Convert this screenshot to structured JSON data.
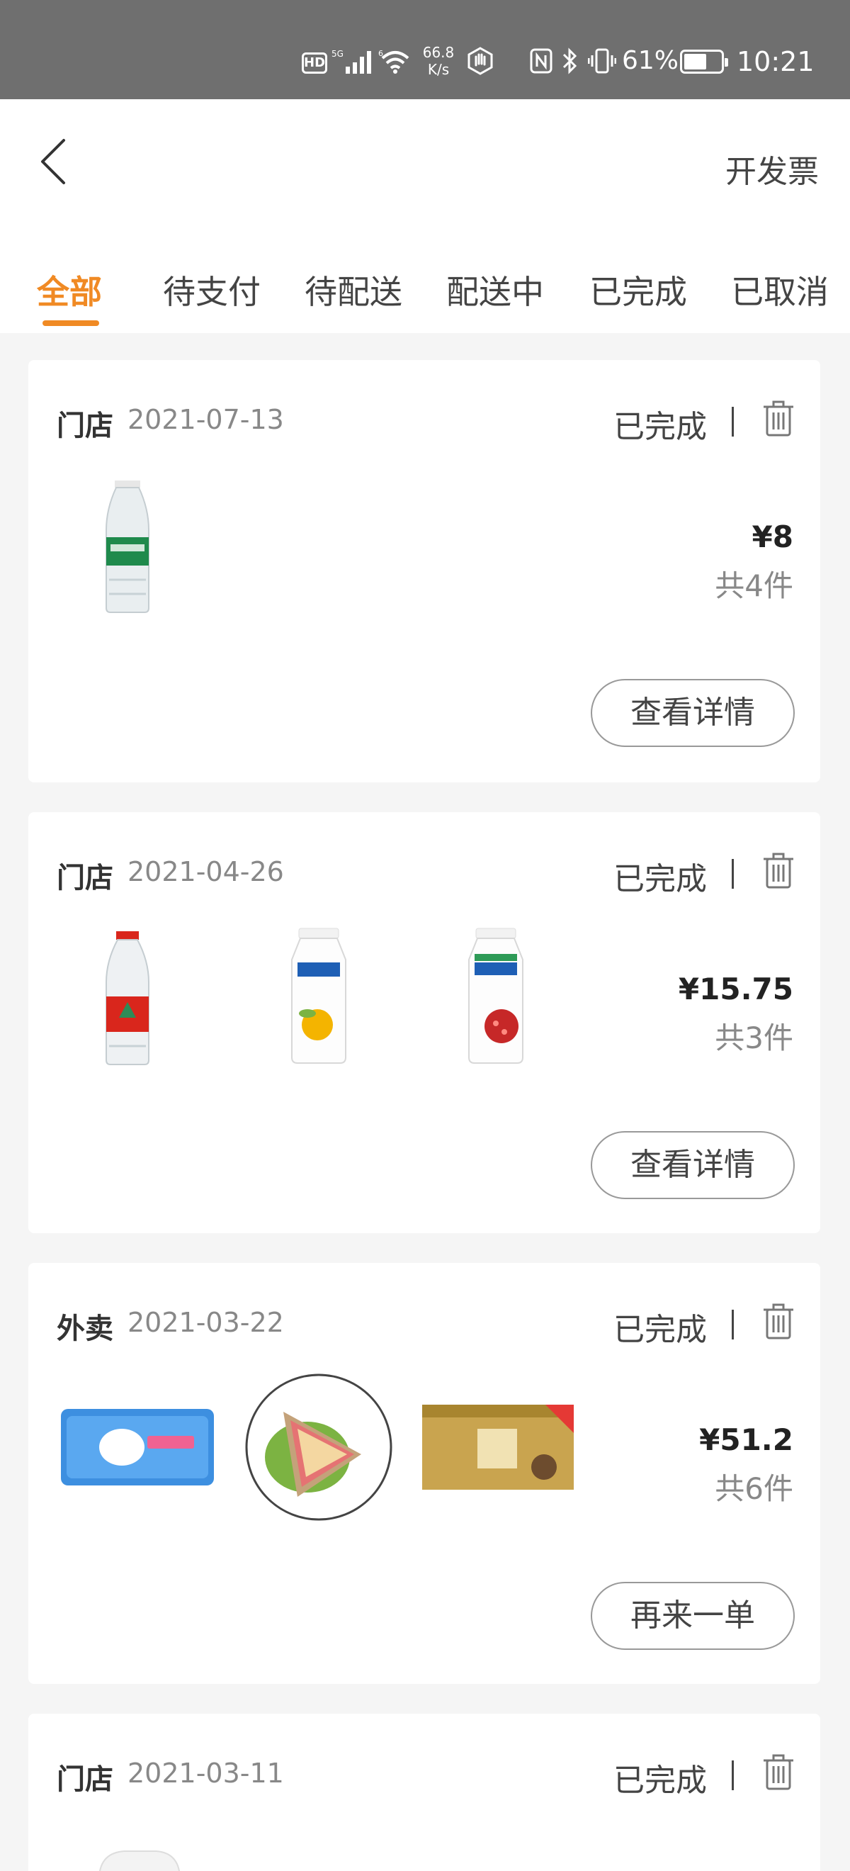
{
  "status_bar": {
    "hd": "HD",
    "network_speed_value": "66.8",
    "network_speed_unit": "K/s",
    "battery_percent": "61%",
    "battery_level": 0.61,
    "time": "10:21"
  },
  "header": {
    "back_icon": "chevron-left-icon",
    "invoice_label": "开发票"
  },
  "tabs": [
    {
      "label": "全部",
      "active": true
    },
    {
      "label": "待支付",
      "active": false
    },
    {
      "label": "待配送",
      "active": false
    },
    {
      "label": "配送中",
      "active": false
    },
    {
      "label": "已完成",
      "active": false
    },
    {
      "label": "已取消",
      "active": false
    }
  ],
  "orders": [
    {
      "source": "门店",
      "date": "2021-07-13",
      "status": "已完成",
      "price": "¥8",
      "quantity": "共4件",
      "action": "查看详情",
      "items": [
        "green-label water bottle"
      ]
    },
    {
      "source": "门店",
      "date": "2021-04-26",
      "status": "已完成",
      "price": "¥15.75",
      "quantity": "共3件",
      "action": "查看详情",
      "items": [
        "water bottle",
        "冠益乳 yogurt",
        "冠益乳 轻衡 yogurt"
      ]
    },
    {
      "source": "外卖",
      "date": "2021-03-22",
      "status": "已完成",
      "price": "¥51.2",
      "quantity": "共6件",
      "action": "再来一单",
      "items": [
        "wet wipes",
        "sandwich",
        "tissue box"
      ]
    },
    {
      "source": "门店",
      "date": "2021-03-11",
      "status": "已完成"
    }
  ],
  "colors": {
    "accent": "#f08a24",
    "status_bar_bg": "#6f6f6f",
    "page_bg": "#f5f5f5"
  }
}
